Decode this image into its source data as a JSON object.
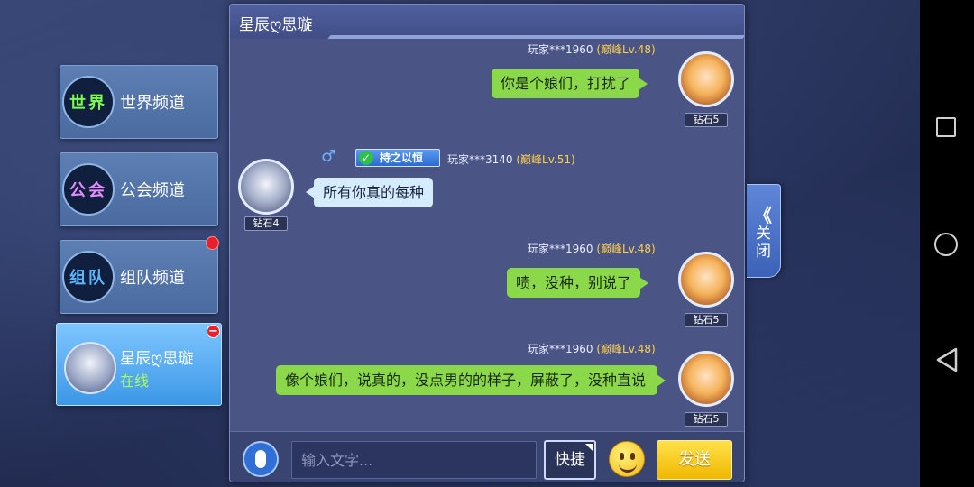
{
  "channels": [
    {
      "badge": "世界",
      "label": "世界频道",
      "badge_color": "#7dff4a"
    },
    {
      "badge": "公会",
      "label": "公会频道",
      "badge_color": "#e38bff"
    },
    {
      "badge": "组队",
      "label": "组队频道",
      "badge_color": "#5ab8ff"
    }
  ],
  "active_chat": {
    "name": "星辰ღ思璇",
    "status": "在线"
  },
  "panel": {
    "title": "星辰ღ思璇"
  },
  "messages": [
    {
      "sender": "玩家***1960",
      "level": "(巅峰Lv.48)",
      "text": "你是个娘们，打扰了",
      "rank": "钻石5",
      "side": "right"
    },
    {
      "sender": "玩家***3140",
      "level": "(巅峰Lv.51)",
      "text": "所有你真的每种",
      "rank": "钻石4",
      "side": "left",
      "title_badge": "持之以恒",
      "gender": "♂"
    },
    {
      "sender": "玩家***1960",
      "level": "(巅峰Lv.48)",
      "text": "啧，没种，别说了",
      "rank": "钻石5",
      "side": "right"
    },
    {
      "sender": "玩家***1960",
      "level": "(巅峰Lv.48)",
      "text": "像个娘们，说真的，没点男的的样子，屏蔽了，没种直说",
      "rank": "钻石5",
      "side": "right"
    }
  ],
  "input": {
    "placeholder": "输入文字..."
  },
  "buttons": {
    "quick": "快捷",
    "send": "发送"
  },
  "close_tab": {
    "chevron": "《",
    "label": "关闭"
  },
  "icons": [
    "mic-icon",
    "emoji-icon",
    "square-nav-icon",
    "circle-nav-icon",
    "back-nav-icon"
  ]
}
